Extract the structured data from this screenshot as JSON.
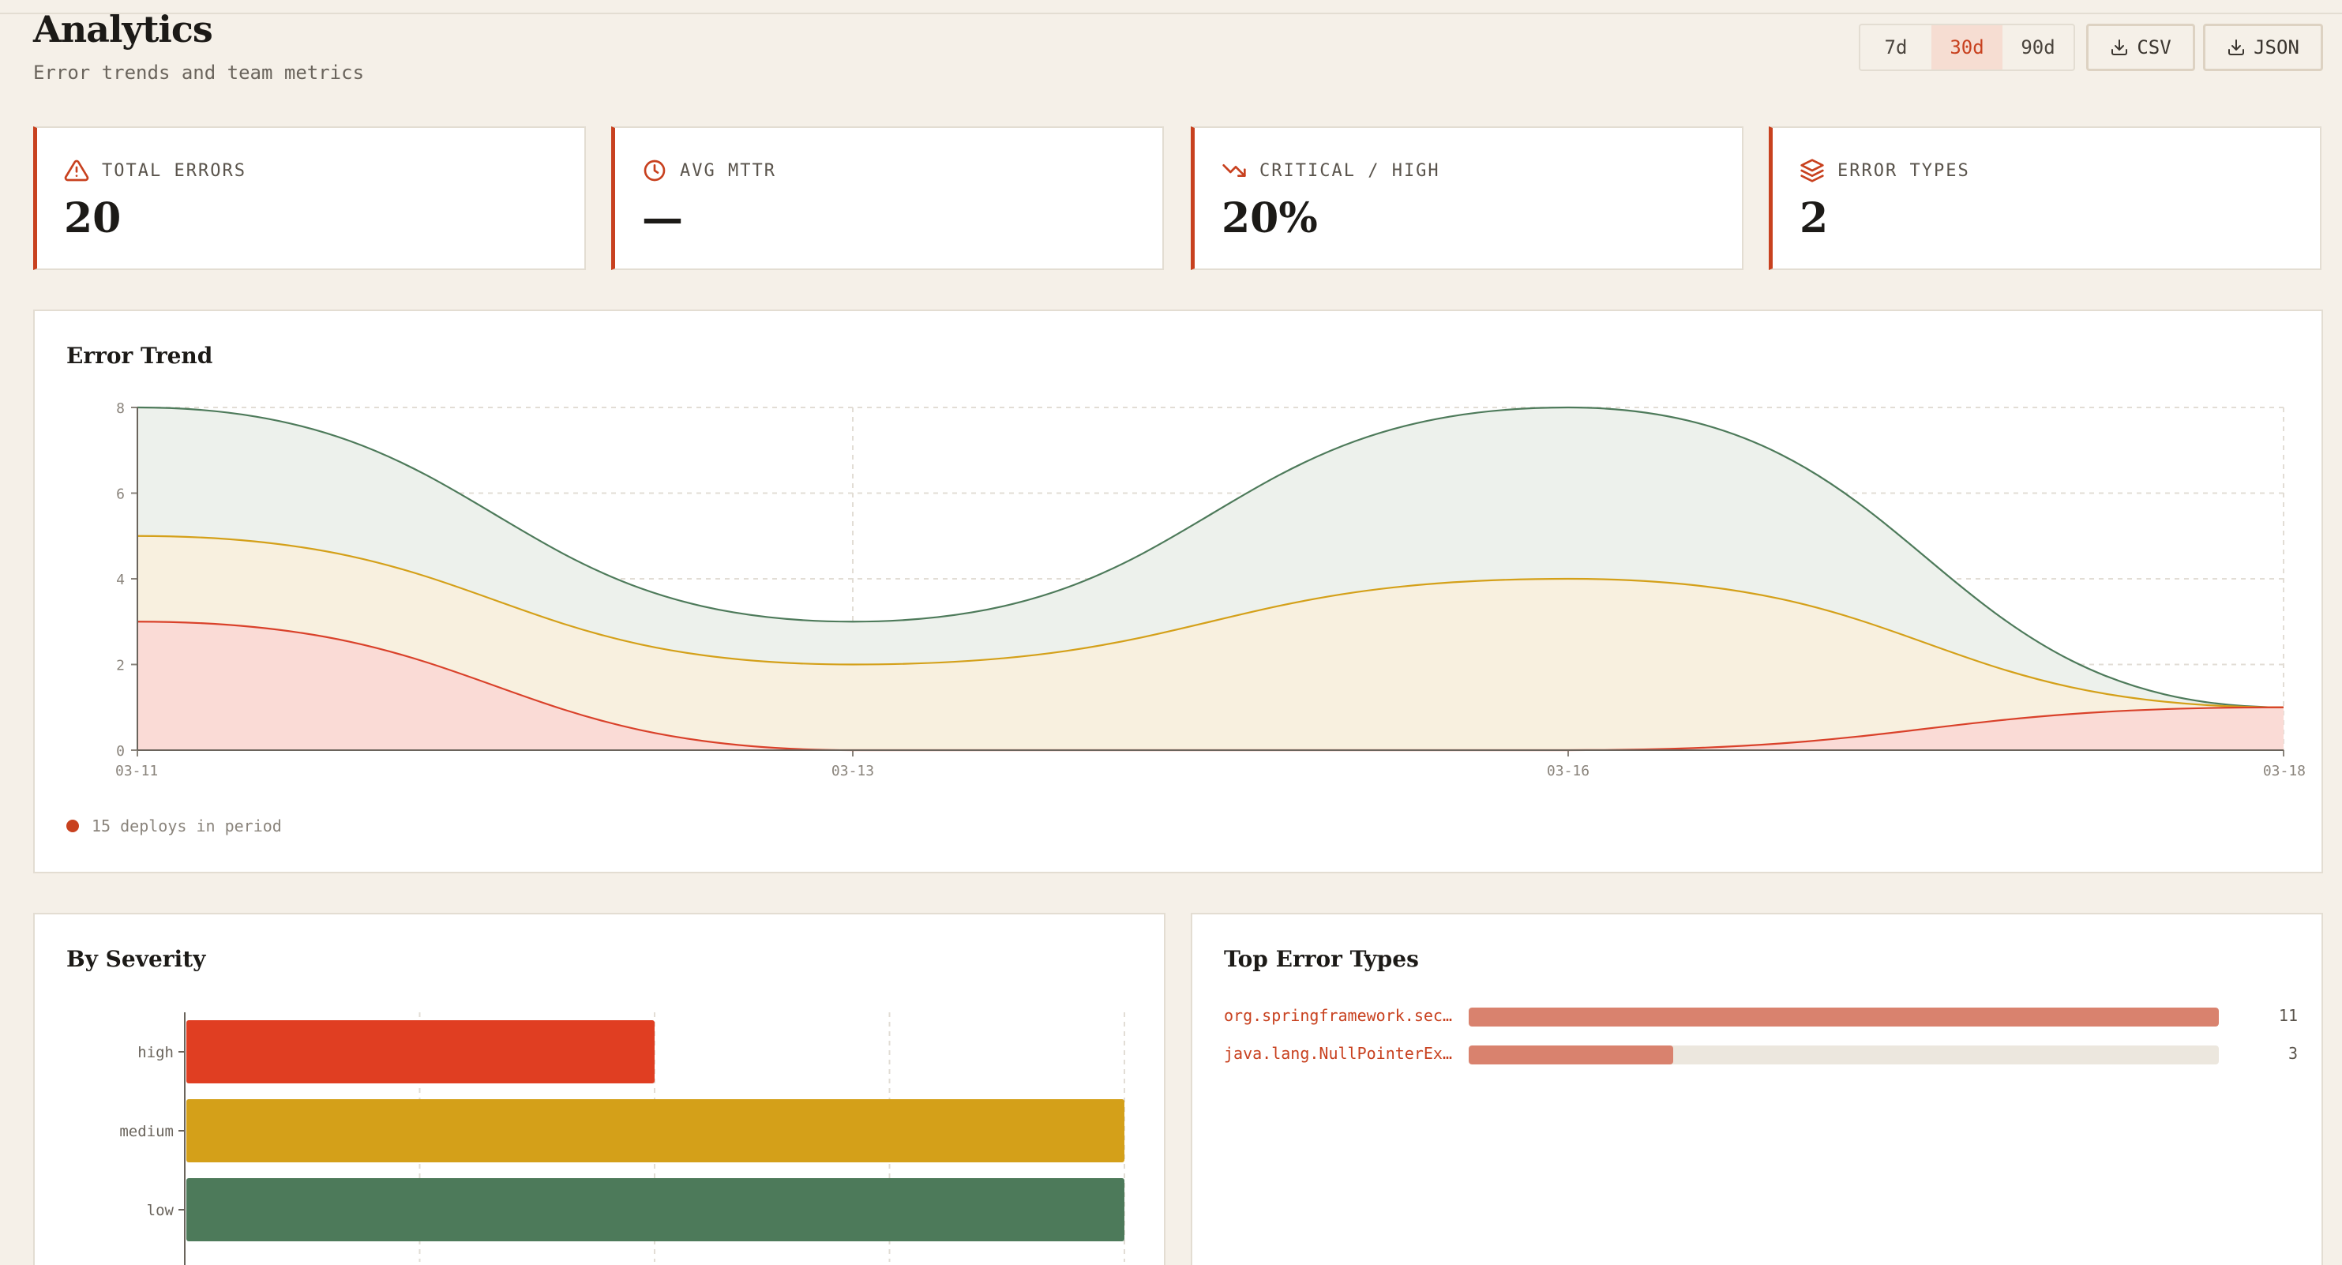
{
  "header": {
    "title": "Analytics",
    "subtitle": "Error trends and team metrics"
  },
  "range_selector": {
    "options": [
      "7d",
      "30d",
      "90d"
    ],
    "selected": "30d"
  },
  "export": {
    "csv_label": "CSV",
    "json_label": "JSON",
    "icon": "download-icon"
  },
  "stats": [
    {
      "label": "TOTAL ERRORS",
      "value": "20",
      "icon": "alert-triangle-icon"
    },
    {
      "label": "AVG MTTR",
      "value": "—",
      "icon": "clock-icon"
    },
    {
      "label": "CRITICAL / HIGH",
      "value": "20%",
      "icon": "trending-down-icon"
    },
    {
      "label": "ERROR TYPES",
      "value": "2",
      "icon": "layers-icon"
    }
  ],
  "trend": {
    "title": "Error Trend",
    "deploy_note": "15 deploys in period"
  },
  "severity": {
    "title": "By Severity"
  },
  "top_errors": {
    "title": "Top Error Types",
    "items": [
      {
        "name": "org.springframework.sec…",
        "count": "11",
        "value": 11
      },
      {
        "name": "java.lang.NullPointerEx…",
        "count": "3",
        "value": 3
      }
    ],
    "max": 11
  },
  "colors": {
    "accent": "#c8411f",
    "total": "#4d7a5a",
    "medium": "#d4a019",
    "high": "#e03e22",
    "low": "#4d7a5a"
  },
  "chart_data": [
    {
      "type": "area",
      "title": "Error Trend",
      "x": [
        "03-11",
        "03-13",
        "03-16",
        "03-18"
      ],
      "ylim": [
        0,
        8
      ],
      "yticks": [
        0,
        2,
        4,
        6,
        8
      ],
      "grid": true,
      "series": [
        {
          "values": [
            8,
            3,
            8,
            1
          ],
          "color": "#4d7a5a",
          "fill": "#edf1ec"
        },
        {
          "values": [
            5,
            2,
            4,
            1
          ],
          "color": "#d4a019",
          "fill": "#f8f0df"
        },
        {
          "values": [
            3,
            0,
            0,
            1
          ],
          "color": "#d9412a",
          "fill": "#fadbd6"
        }
      ]
    },
    {
      "type": "bar",
      "orientation": "horizontal",
      "title": "By Severity",
      "categories": [
        "high",
        "medium",
        "low"
      ],
      "values": [
        2,
        4,
        4
      ],
      "xlim": [
        0,
        4
      ],
      "grid": true,
      "colors": [
        "#e03e22",
        "#d4a019",
        "#4d7a5a"
      ]
    }
  ]
}
